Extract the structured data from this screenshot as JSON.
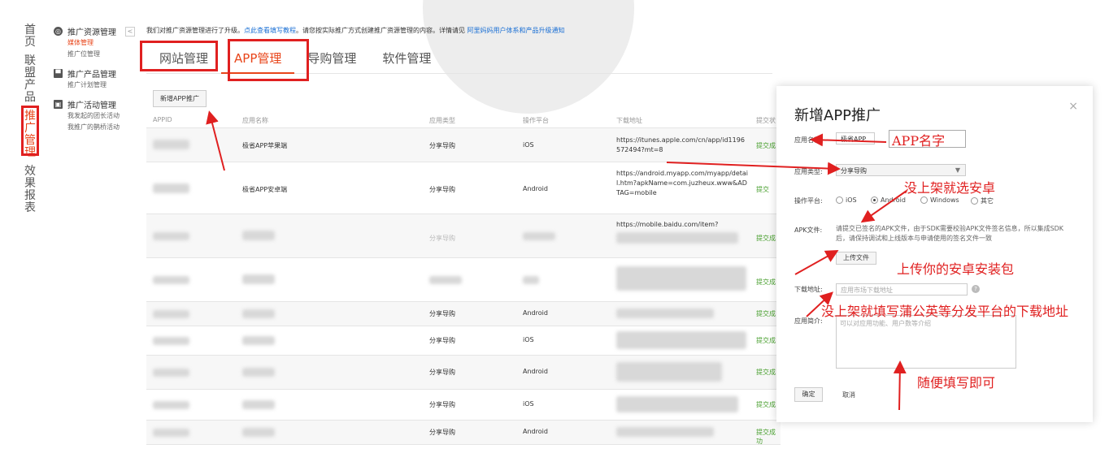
{
  "left_nav": [
    "首页",
    "联盟产品",
    "推广管理",
    "效果报表"
  ],
  "side_groups": [
    {
      "title": "推广资源管理",
      "icon": "globe-icon",
      "items": [
        "媒体管理",
        "推广位管理"
      ]
    },
    {
      "title": "推广产品管理",
      "icon": "flag-icon",
      "items": [
        "推广计划管理"
      ]
    },
    {
      "title": "推广活动管理",
      "icon": "gift-icon",
      "items": [
        "我发起的团长活动",
        "我推广的鹊桥活动"
      ]
    }
  ],
  "collapse_glyph": "<",
  "notice": {
    "text": "我们对推广资源管理进行了升级。",
    "link1": "点此查看填写教程",
    "text2": "。请您按实际推广方式创建推广资源管理的内容。详情请见",
    "link2": "阿里妈妈用户体系和产品升级通知"
  },
  "tabs": [
    "网站管理",
    "APP管理",
    "导购管理",
    "软件管理"
  ],
  "add_button": "新增APP推广",
  "columns": [
    "APPID",
    "应用名称",
    "应用类型",
    "操作平台",
    "下载地址",
    "提交状"
  ],
  "rows": [
    {
      "name": "极省APP苹果端",
      "type": "分享导购",
      "platform": "iOS",
      "url": "https://itunes.apple.com/cn/app/id1196572494?mt=8",
      "status": "提交成"
    },
    {
      "name": "极省APP安卓端",
      "type": "分享导购",
      "platform": "Android",
      "url": "https://android.myapp.com/myapp/detail.htm?apkName=com.juzheux.www&ADTAG=mobile",
      "status": "提交"
    },
    {
      "name": "",
      "type": "分享导购",
      "platform": "",
      "url": "https://mobile.baidu.com/item?",
      "status": "提交成"
    },
    {
      "name": "",
      "type": "",
      "platform": "",
      "url": "",
      "status": "提交成"
    },
    {
      "name": "",
      "type": "分享导购",
      "platform": "Android",
      "url": "",
      "status": "提交成"
    },
    {
      "name": "",
      "type": "分享导购",
      "platform": "iOS",
      "url": "",
      "status": "提交成"
    },
    {
      "name": "",
      "type": "分享导购",
      "platform": "Android",
      "url": "",
      "status": "提交成"
    },
    {
      "name": "",
      "type": "分享导购",
      "platform": "iOS",
      "url": "",
      "status": "提交成"
    },
    {
      "name": "",
      "type": "分享导购",
      "platform": "Android",
      "url": "",
      "status": "提交成功"
    }
  ],
  "dialog": {
    "title": "新增APP推广",
    "close": "×",
    "name_label": "应用名称:",
    "name_value": "极省APP",
    "type_label": "应用类型:",
    "type_value": "分享导购",
    "platform_label": "操作平台:",
    "platforms": [
      "iOS",
      "Android",
      "Windows",
      "其它"
    ],
    "platform_selected": "Android",
    "apk_label": "APK文件:",
    "apk_hint": "请提交已签名的APK文件，由于SDK需要校验APK文件签名信息，所以集成SDK后，请保持调试和上线版本与申请使用的签名文件一致",
    "upload": "上传文件",
    "download_label": "下载地址:",
    "download_placeholder": "应用市场下载地址",
    "intro_label": "应用简介:",
    "intro_placeholder": "可以对应用功能、用户数等介绍",
    "ok": "确定",
    "cancel": "取消"
  },
  "annotations": {
    "app_name": "APP名字",
    "android": "没上架就选安卓",
    "upload": "上传你的安卓安装包",
    "download": "没上架就填写蒲公英等分发平台的下载地址",
    "intro": "随便填写即可"
  },
  "accent": "#e8451a",
  "annotation_color": "#e02020"
}
